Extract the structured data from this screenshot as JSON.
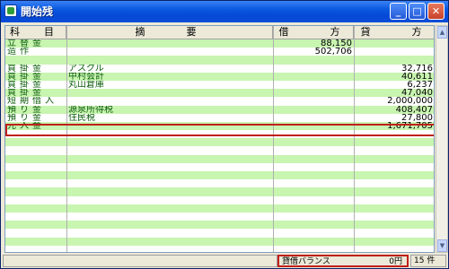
{
  "window": {
    "title": "開始残",
    "icon": "ledger-icon",
    "buttons": {
      "minimize": "_",
      "maximize": "□",
      "close": "✕"
    }
  },
  "columns": [
    "科　目",
    "摘　　要",
    "借　　方",
    "貸　　方"
  ],
  "rows": [
    {
      "account": "立替金",
      "memo": "",
      "debit": "88,150",
      "credit": ""
    },
    {
      "account": "造作",
      "memo": "",
      "debit": "502,706",
      "credit": ""
    },
    {
      "account": "",
      "memo": "",
      "debit": "",
      "credit": ""
    },
    {
      "account": "買掛金",
      "memo": "アスクル",
      "debit": "",
      "credit": "32,716"
    },
    {
      "account": "買掛金",
      "memo": "中村会計",
      "debit": "",
      "credit": "40,611"
    },
    {
      "account": "買掛金",
      "memo": "丸山倉庫",
      "debit": "",
      "credit": "6,237"
    },
    {
      "account": "買掛金",
      "memo": "",
      "debit": "",
      "credit": "47,040"
    },
    {
      "account": "短期借入",
      "memo": "",
      "debit": "",
      "credit": "2,000,000"
    },
    {
      "account": "預り金",
      "memo": "源泉所得税",
      "debit": "",
      "credit": "408,407"
    },
    {
      "account": "預り金",
      "memo": "住民税",
      "debit": "",
      "credit": "27,800"
    },
    {
      "account": "元入金",
      "memo": "",
      "debit": "",
      "credit": "1,671,705"
    }
  ],
  "status": {
    "balance_label": "貸借バランス",
    "balance_value": "0円",
    "count": "15 件"
  },
  "colors": {
    "stripe_green": "#c8f5b0",
    "highlight_red": "#c0201a"
  }
}
